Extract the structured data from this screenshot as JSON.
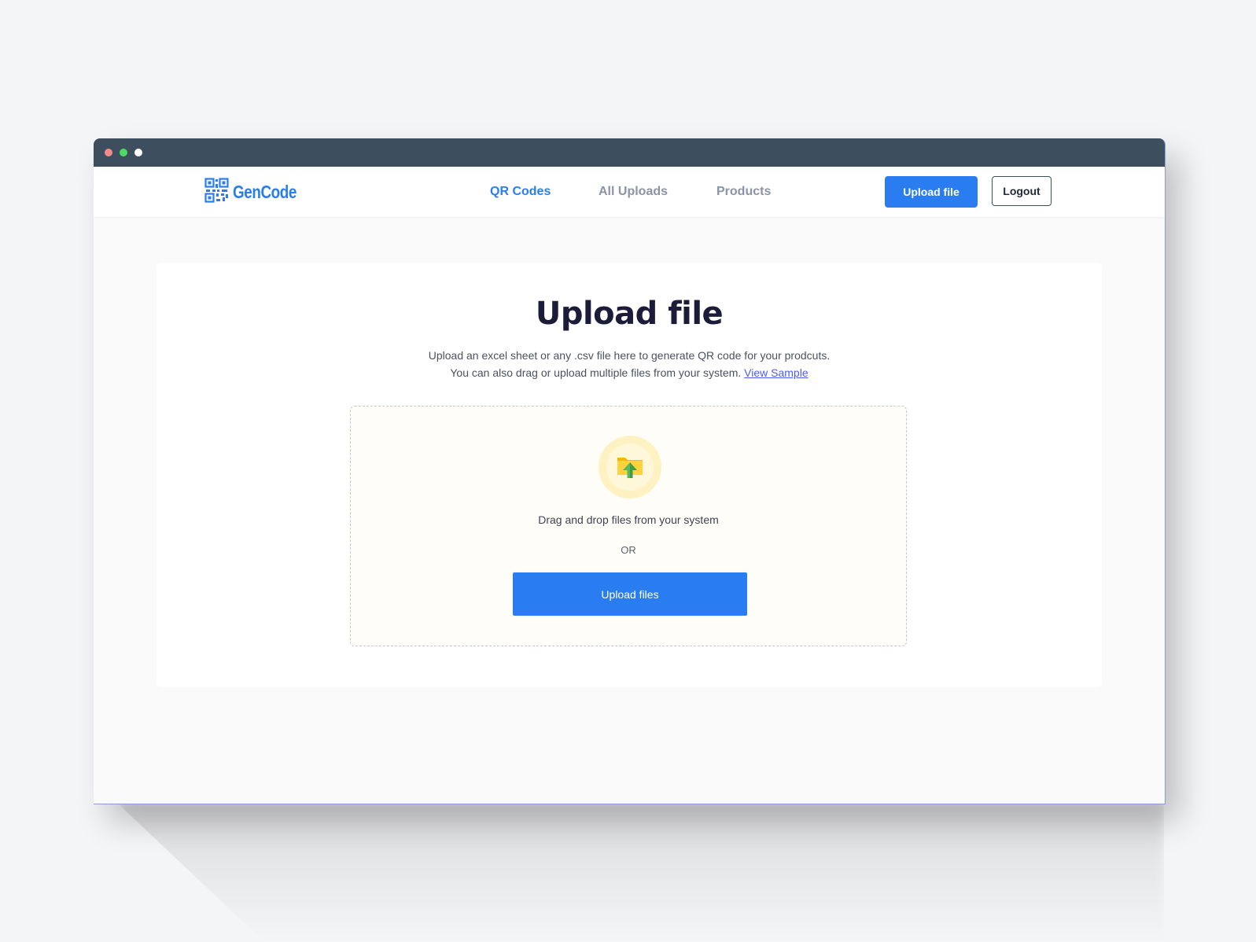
{
  "window": {
    "controls": [
      "close",
      "minimize",
      "maximize"
    ]
  },
  "header": {
    "logo_text": "GenCode",
    "logo_icon": "qr-code-icon",
    "nav": [
      {
        "label": "QR Codes",
        "active": true
      },
      {
        "label": "All Uploads",
        "active": false
      },
      {
        "label": "Products",
        "active": false
      }
    ],
    "upload_button_label": "Upload file",
    "logout_button_label": "Logout"
  },
  "main": {
    "title": "Upload file",
    "description_line1": "Upload an excel sheet or any .csv file here to generate QR code for your prodcuts.",
    "description_line2": "You can also drag or upload multiple files from your system.",
    "view_sample_link": "View Sample",
    "dropzone": {
      "icon": "folder-upload-icon",
      "drag_text": "Drag and drop files from your system",
      "or_text": "OR",
      "upload_files_label": "Upload files"
    }
  },
  "colors": {
    "accent": "#2a7df0",
    "titlebar": "#3d4f5f",
    "title_text": "#1c1b3a",
    "link": "#4a5cf0",
    "dropzone_bg": "#fffdf8"
  }
}
